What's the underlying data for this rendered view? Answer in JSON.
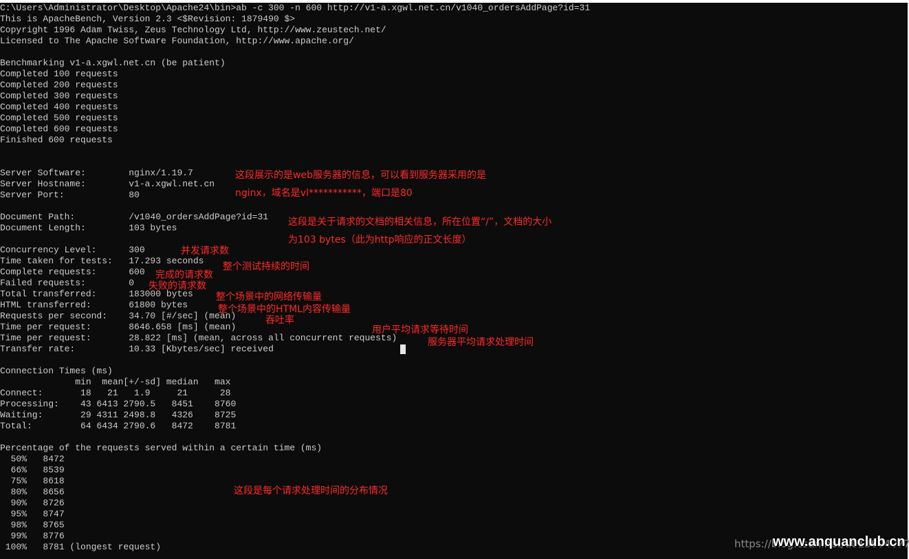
{
  "terminal": {
    "lines": [
      "C:\\Users\\Administrator\\Desktop\\Apache24\\bin>ab -c 300 -n 600 http://v1-a.xgwl.net.cn/v1040_ordersAddPage?id=31",
      "This is ApacheBench, Version 2.3 <$Revision: 1879490 $>",
      "Copyright 1996 Adam Twiss, Zeus Technology Ltd, http://www.zeustech.net/",
      "Licensed to The Apache Software Foundation, http://www.apache.org/",
      "",
      "Benchmarking v1-a.xgwl.net.cn (be patient)",
      "Completed 100 requests",
      "Completed 200 requests",
      "Completed 300 requests",
      "Completed 400 requests",
      "Completed 500 requests",
      "Completed 600 requests",
      "Finished 600 requests",
      "",
      "",
      "Server Software:        nginx/1.19.7",
      "Server Hostname:        v1-a.xgwl.net.cn",
      "Server Port:            80",
      "",
      "Document Path:          /v1040_ordersAddPage?id=31",
      "Document Length:        103 bytes",
      "",
      "Concurrency Level:      300",
      "Time taken for tests:   17.293 seconds",
      "Complete requests:      600",
      "Failed requests:        0",
      "Total transferred:      183000 bytes",
      "HTML transferred:       61800 bytes",
      "Requests per second:    34.70 [#/sec] (mean)",
      "Time per request:       8646.658 [ms] (mean)",
      "Time per request:       28.822 [ms] (mean, across all concurrent requests)",
      "Transfer rate:          10.33 [Kbytes/sec] received",
      "",
      "Connection Times (ms)",
      "              min  mean[+/-sd] median   max",
      "Connect:       18   21   1.9     21      28",
      "Processing:    43 6413 2790.5   8451    8760",
      "Waiting:       29 4311 2498.8   4326    8725",
      "Total:         64 6434 2790.6   8472    8781",
      "",
      "Percentage of the requests served within a certain time (ms)",
      "  50%   8472",
      "  66%   8539",
      "  75%   8618",
      "  80%   8656",
      "  90%   8726",
      "  95%   8747",
      "  98%   8765",
      "  99%   8776",
      " 100%   8781 (longest request)"
    ]
  },
  "annotations": {
    "server_info_1": "这段展示的是web服务器的信息，可以看到服务器采用的是",
    "server_info_2": "nginx，域名是vl***********，端口是80",
    "doc_info_1": "这段是关于请求的文档的相关信息，所在位置“/”，文档的大小",
    "doc_info_2": "为103 bytes（此为http响应的正文长度）",
    "concurrency": "并发请求数",
    "time_taken": "整个测试持续的时间",
    "complete": "完成的请求数",
    "failed": "失败的请求数",
    "total_transferred": "整个场景中的网络传输量",
    "html_transferred": "整个场景中的HTML内容传输量",
    "throughput": "吞吐率",
    "user_wait": "用户平均请求等待时间",
    "server_time": "服务器平均请求处理时间",
    "distribution": "这段是每个请求处理时间的分布情况"
  },
  "watermark": {
    "text": "https://blog.csdn.net/u013604077",
    "overlay": "www.anquanclub.cn"
  },
  "colors": {
    "console_bg": "#0c0c0c",
    "console_text": "#cccccc",
    "annotation": "#ff2a2a"
  }
}
